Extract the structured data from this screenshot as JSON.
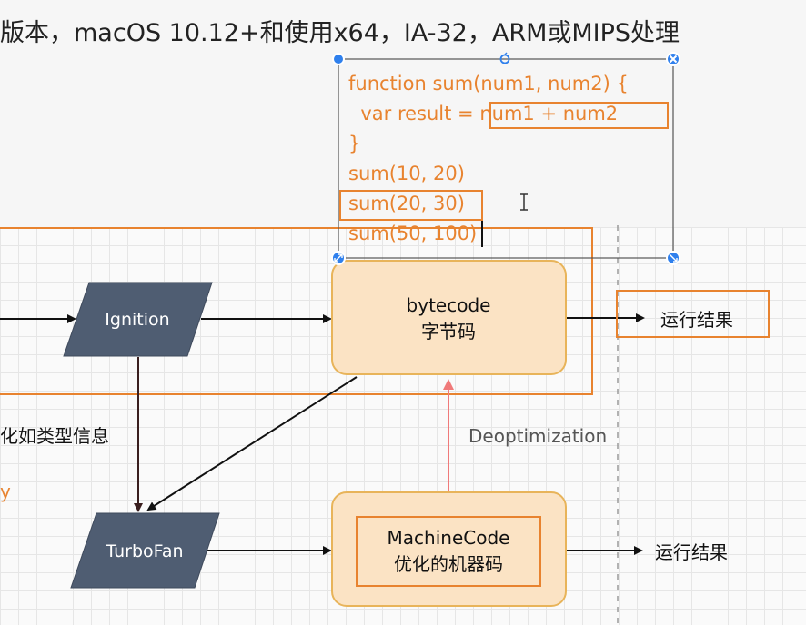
{
  "header_text": "版本，macOS 10.12+和使用x64，IA-32，ARM或MIPS处理",
  "code": {
    "line1": "function sum(num1, num2) {",
    "line2_prefix": "  var result = ",
    "line2_highlight": "num1 + num2",
    "line3": "}",
    "line4": "sum(10, 20)",
    "line5": "sum(20, 30)",
    "line6": "sum(50, 100)"
  },
  "nodes": {
    "ignition": "Ignition",
    "turbofan": "TurboFan",
    "bytecode_line1": "bytecode",
    "bytecode_line2": "字节码",
    "machinecode_line1": "MachineCode",
    "machinecode_line2": "优化的机器码",
    "result_top": "运行结果",
    "result_bottom": "运行结果"
  },
  "labels": {
    "deoptimization": "Deoptimization",
    "type_info": "化如类型信息",
    "orange_fragment": "y"
  },
  "colors": {
    "accent_orange": "#e8832f",
    "node_slate": "#4f5d72",
    "node_fill": "#fbe3c4",
    "node_border": "#e8b45a",
    "deopt_red": "#f07a7a",
    "handle_blue": "#2f80ed"
  }
}
